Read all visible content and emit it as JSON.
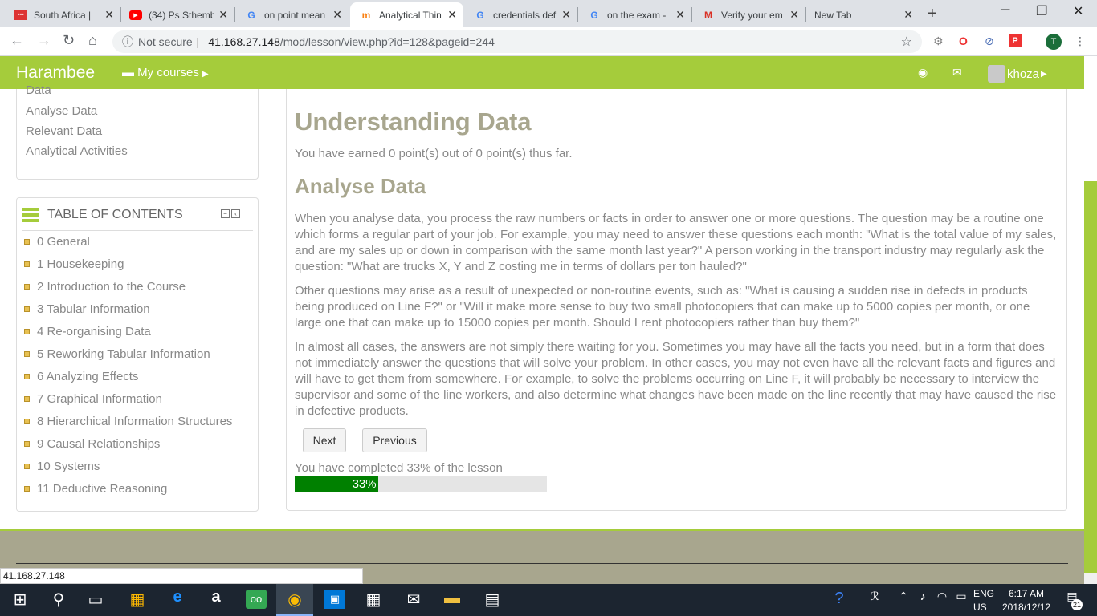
{
  "browser": {
    "tabs": [
      {
        "label": "South Africa | ",
        "icon": "news-icon"
      },
      {
        "label": "(34) Ps Sthemb",
        "icon": "youtube-icon"
      },
      {
        "label": "on point mean",
        "icon": "google-icon"
      },
      {
        "label": "Analytical Thin",
        "icon": "moodle-icon",
        "active": true
      },
      {
        "label": "credentials def",
        "icon": "google-icon"
      },
      {
        "label": "on the exam - ",
        "icon": "google-icon"
      },
      {
        "label": "Verify your em",
        "icon": "gmail-icon"
      },
      {
        "label": "New Tab",
        "icon": ""
      }
    ],
    "security": "Not secure",
    "url_host": "41.168.27.148",
    "url_path": "/mod/lesson/view.php?id=128&pageid=244",
    "profile_initial": "T",
    "status_url": "41.168.27.148"
  },
  "navbar": {
    "brand": "Harambee",
    "my_courses": "My courses",
    "user": "khoza"
  },
  "sidebar": {
    "links": [
      "Data",
      "Analyse Data",
      "Relevant Data",
      "Analytical Activities"
    ],
    "toc_title": "TABLE OF CONTENTS",
    "toc_items": [
      "0 General",
      "1 Housekeeping",
      "2 Introduction to the Course",
      "3 Tabular Information",
      "4 Re-organising Data",
      "5 Reworking Tabular Information",
      "6 Analyzing Effects",
      "7 Graphical Information",
      "8 Hierarchical Information Structures",
      "9 Causal Relationships",
      "10 Systems",
      "11 Deductive Reasoning"
    ]
  },
  "main": {
    "title": "Understanding Data",
    "earned": "You have earned 0 point(s) out of 0 point(s) thus far.",
    "subtitle": "Analyse Data",
    "p1": "When you analyse data, you process the raw numbers or facts in order to answer one or more questions. The question may be a routine one which forms a regular part of your job. For example, you may need to answer these questions each month: \"What is the total value of my sales, and are my sales up or down in comparison with the same month last year?\" A person working in the transport industry may regularly ask the question: \"What are trucks X, Y and Z costing me in terms of dollars per ton hauled?\"",
    "p2": "Other questions may arise as a result of unexpected or non-routine events, such as: \"What is causing a sudden rise in defects in products being produced on Line F?\" or \"Will it make more sense to buy two small photocopiers that can make up to 5000 copies per month, or one large one that can make up to 15000 copies per month. Should I rent photocopiers rather than buy them?\"",
    "p3": "In almost all cases, the answers are not simply there waiting for you. Sometimes you may have all the facts you need, but in a form that does not immediately answer the questions that will solve your problem. In other cases, you may not even have all the relevant facts and figures and will have to get them from somewhere. For example, to solve the problems occurring on Line F, it will probably be necessary to interview the supervisor and some of the line workers, and also determine what changes have been made on the line recently that may have caused the rise in defective products.",
    "next_label": "Next",
    "previous_label": "Previous",
    "completed_text": "You have completed 33% of the lesson",
    "progress_label": "33%",
    "progress_value": 0.33
  },
  "taskbar": {
    "lang": "ENG",
    "region": "US",
    "time": "6:17 AM",
    "date": "2018/12/12",
    "notifications": "21"
  },
  "colors": {
    "accent": "#a5cc3b",
    "heading": "#a8a68e",
    "progress": "#008000"
  }
}
